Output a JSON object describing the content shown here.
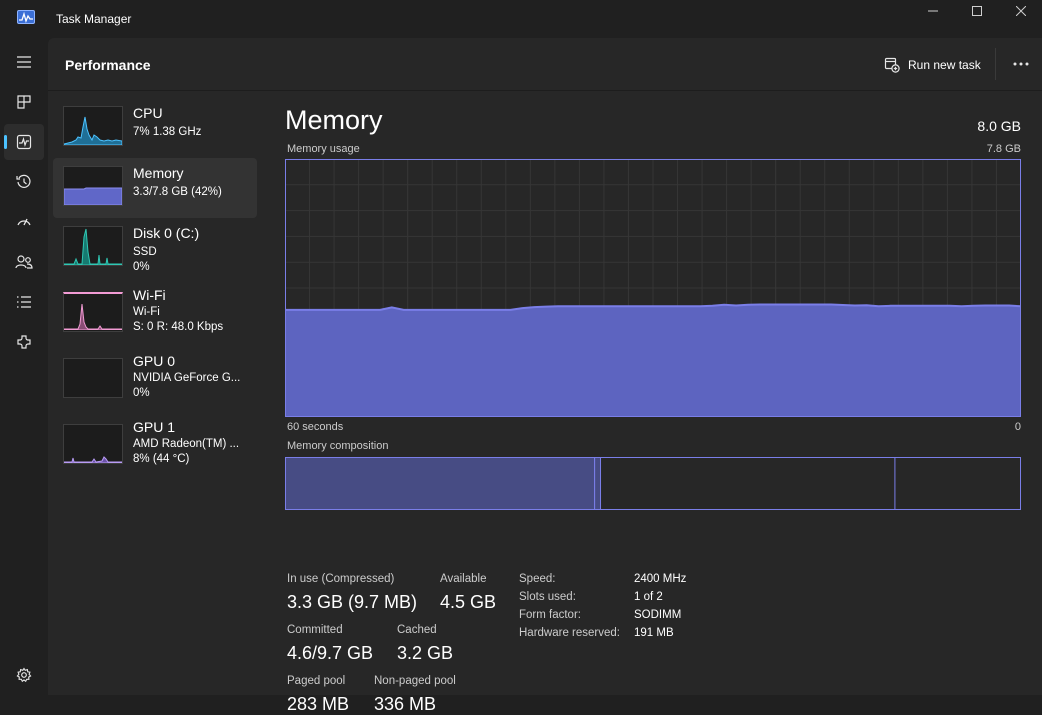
{
  "window": {
    "title": "Task Manager"
  },
  "header": {
    "title": "Performance",
    "run_task_label": "Run new task"
  },
  "nav": {
    "items": [
      {
        "icon": "hamburger-icon"
      },
      {
        "icon": "processes-icon"
      },
      {
        "icon": "performance-icon",
        "active": true
      },
      {
        "icon": "app-history-icon"
      },
      {
        "icon": "startup-apps-icon"
      },
      {
        "icon": "users-icon"
      },
      {
        "icon": "details-icon"
      },
      {
        "icon": "services-icon"
      },
      {
        "icon": "settings-icon"
      }
    ]
  },
  "devices": [
    {
      "name": "CPU",
      "line1": "7%  1.38 GHz",
      "line2": "",
      "color": "#4cc2ff",
      "active": false
    },
    {
      "name": "Memory",
      "line1": "3.3/7.8 GB (42%)",
      "line2": "",
      "color": "#8b8df0",
      "active": true
    },
    {
      "name": "Disk 0 (C:)",
      "line1": "SSD",
      "line2": "0%",
      "color": "#2fc8b4",
      "active": false
    },
    {
      "name": "Wi-Fi",
      "line1": "Wi-Fi",
      "line2": "S: 0  R: 48.0 Kbps",
      "color": "#f29bd4",
      "active": false
    },
    {
      "name": "GPU 0",
      "line1": "NVIDIA GeForce G...",
      "line2": "0%",
      "color": "#b99cf5",
      "active": false
    },
    {
      "name": "GPU 1",
      "line1": "AMD Radeon(TM) ...",
      "line2": "8%  (44 °C)",
      "color": "#b99cf5",
      "active": false
    }
  ],
  "memory": {
    "title": "Memory",
    "total": "8.0 GB",
    "usage_label": "Memory usage",
    "usage_max": "7.8 GB",
    "time_left": "60 seconds",
    "time_right": "0",
    "composition_label": "Memory composition",
    "usage_series": [
      41.5,
      41.5,
      41.5,
      41.5,
      41.5,
      41.5,
      41.5,
      41.5,
      41.5,
      42.5,
      41.5,
      41.5,
      41.5,
      41.5,
      41.5,
      41.5,
      41.5,
      41.5,
      41.5,
      41.5,
      42.2,
      42.6,
      42.8,
      42.9,
      42.9,
      42.9,
      42.9,
      42.9,
      42.9,
      42.9,
      42.9,
      42.9,
      42.9,
      42.9,
      42.9,
      42.9,
      43.1,
      43.5,
      43.2,
      43.5,
      43.6,
      43.6,
      43.6,
      43.6,
      43.6,
      43.6,
      43.6,
      43.4,
      43.2,
      43.3,
      42.9,
      43.1,
      43.1,
      43.1,
      43.1,
      43.1,
      43.1,
      42.9,
      43.1,
      43.2,
      43.2,
      43.2,
      42.9
    ],
    "composition_fractions": {
      "in_use": 0.42,
      "modified": 0.008,
      "standby": 0.4
    },
    "stats": {
      "in_use_label": "In use (Compressed)",
      "in_use_value": "3.3 GB (9.7 MB)",
      "available_label": "Available",
      "available_value": "4.5 GB",
      "committed_label": "Committed",
      "committed_value": "4.6/9.7 GB",
      "cached_label": "Cached",
      "cached_value": "3.2 GB",
      "paged_label": "Paged pool",
      "paged_value": "283 MB",
      "nonpaged_label": "Non-paged pool",
      "nonpaged_value": "336 MB"
    },
    "details": [
      {
        "label": "Speed:",
        "value": "2400 MHz"
      },
      {
        "label": "Slots used:",
        "value": "1 of 2"
      },
      {
        "label": "Form factor:",
        "value": "SODIMM"
      },
      {
        "label": "Hardware reserved:",
        "value": "191 MB"
      }
    ]
  },
  "colors": {
    "memory_line": "#7a7ee8",
    "memory_fill": "#6067c8",
    "composition_fill": "#474c84",
    "grid": "#363636"
  }
}
